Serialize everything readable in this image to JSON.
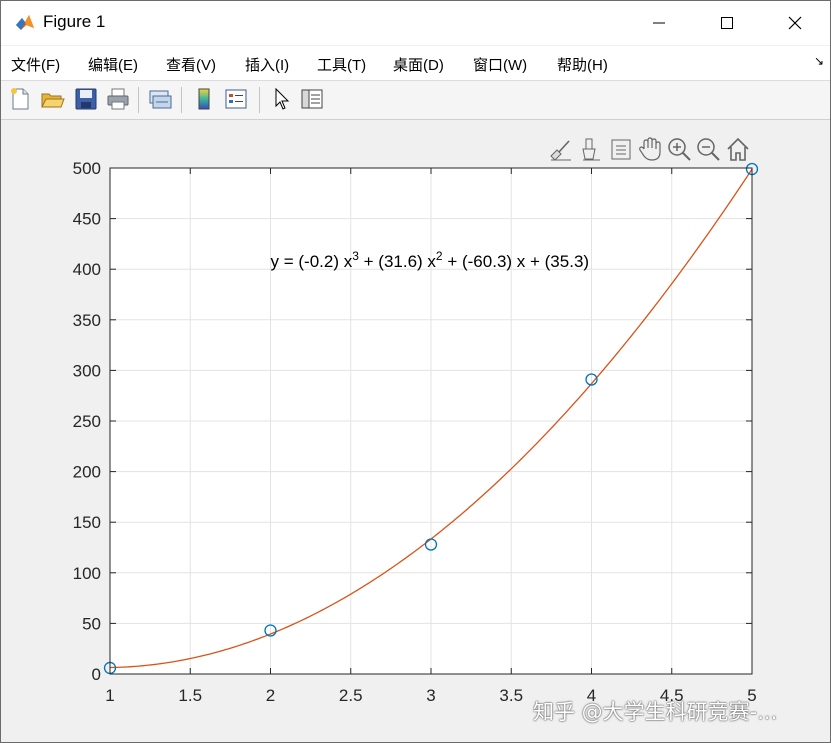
{
  "window": {
    "title": "Figure 1"
  },
  "menu": {
    "items": [
      {
        "label": "文件(F)",
        "name": "menu-file"
      },
      {
        "label": "编辑(E)",
        "name": "menu-edit"
      },
      {
        "label": "查看(V)",
        "name": "menu-view"
      },
      {
        "label": "插入(I)",
        "name": "menu-insert"
      },
      {
        "label": "工具(T)",
        "name": "menu-tools"
      },
      {
        "label": "桌面(D)",
        "name": "menu-desktop"
      },
      {
        "label": "窗口(W)",
        "name": "menu-window"
      },
      {
        "label": "帮助(H)",
        "name": "menu-help"
      }
    ],
    "overflow": "↘"
  },
  "toolbar": {
    "icons": [
      "new-figure-icon",
      "open-file-icon",
      "save-icon",
      "print-icon",
      "link-plot-icon",
      "colorbar-icon",
      "legend-icon",
      "edit-plot-icon",
      "property-inspector-icon"
    ]
  },
  "axes_toolbar": {
    "icons": [
      "brush-icon",
      "data-tips-icon",
      "export-icon",
      "pan-icon",
      "zoom-in-icon",
      "zoom-out-icon",
      "home-icon"
    ]
  },
  "chart_data": {
    "type": "scatter",
    "title": "",
    "xlabel": "",
    "ylabel": "",
    "xlim": [
      1,
      5
    ],
    "ylim": [
      0,
      500
    ],
    "xticks": [
      "1",
      "1.5",
      "2",
      "2.5",
      "3",
      "3.5",
      "4",
      "4.5",
      "5"
    ],
    "yticks": [
      "0",
      "50",
      "100",
      "150",
      "200",
      "250",
      "300",
      "350",
      "400",
      "450",
      "500"
    ],
    "grid": true,
    "series": [
      {
        "type": "scatter",
        "marker": "circle",
        "color": "#0072bd",
        "x": [
          1,
          2,
          3,
          4,
          5
        ],
        "y": [
          6,
          43,
          128,
          291,
          499
        ]
      },
      {
        "type": "line",
        "color": "#d95319",
        "equation": "y = (-0.2) x^3 + (31.6) x^2 + (-60.3) x + (35.3)",
        "coefficients": [
          -0.2,
          31.6,
          -60.3,
          35.3
        ]
      }
    ],
    "annotation": {
      "parts": {
        "p1": "y = (-0.2) x",
        "exp1": "3",
        "p2": " + (31.6) x",
        "exp2": "2",
        "p3": " + (-60.3) x + (35.3)"
      },
      "at": [
        2.0,
        400
      ]
    }
  },
  "watermark": "知乎 @大学生科研竞赛-..."
}
